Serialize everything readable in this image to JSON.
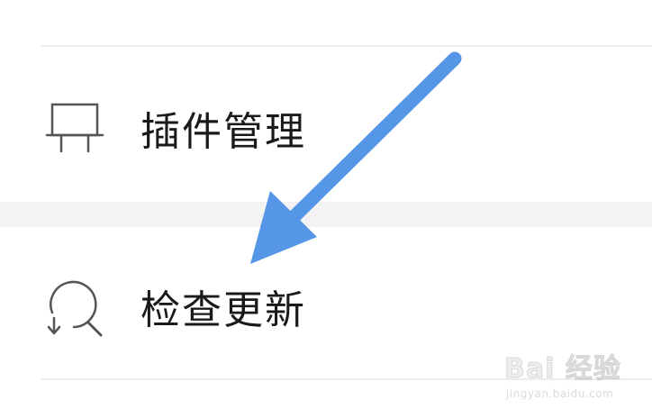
{
  "menu": {
    "items": [
      {
        "label": "插件管理",
        "icon": "plugin-icon"
      },
      {
        "label": "检查更新",
        "icon": "check-update-icon"
      }
    ]
  },
  "annotation": {
    "arrow_color": "#5596e6"
  },
  "watermark": {
    "brand": "Bai 经验",
    "domain": "jingyan.baidu.com"
  }
}
